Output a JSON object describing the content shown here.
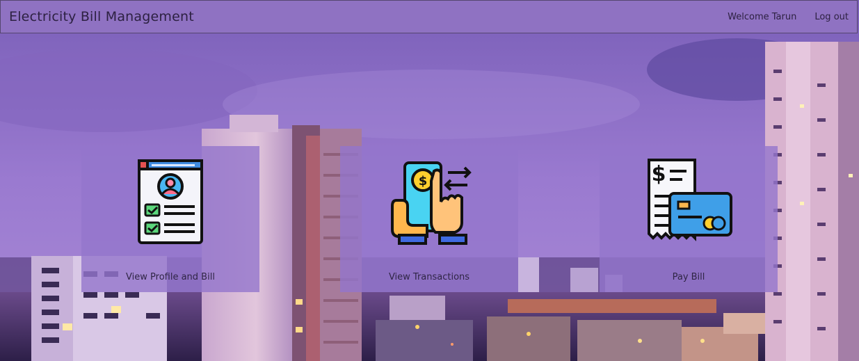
{
  "navbar": {
    "brand": "Electricity Bill Management",
    "welcome": "Welcome Tarun",
    "logout": "Log out"
  },
  "cards": [
    {
      "label": "View Profile and Bill",
      "icon": "profile-document-icon"
    },
    {
      "label": "View Transactions",
      "icon": "mobile-payment-transfer-icon"
    },
    {
      "label": "Pay Bill",
      "icon": "receipt-card-icon"
    }
  ],
  "colors": {
    "navbar": "#8f72c2",
    "card": "#9476cc",
    "sky": "#8a6ec9"
  }
}
